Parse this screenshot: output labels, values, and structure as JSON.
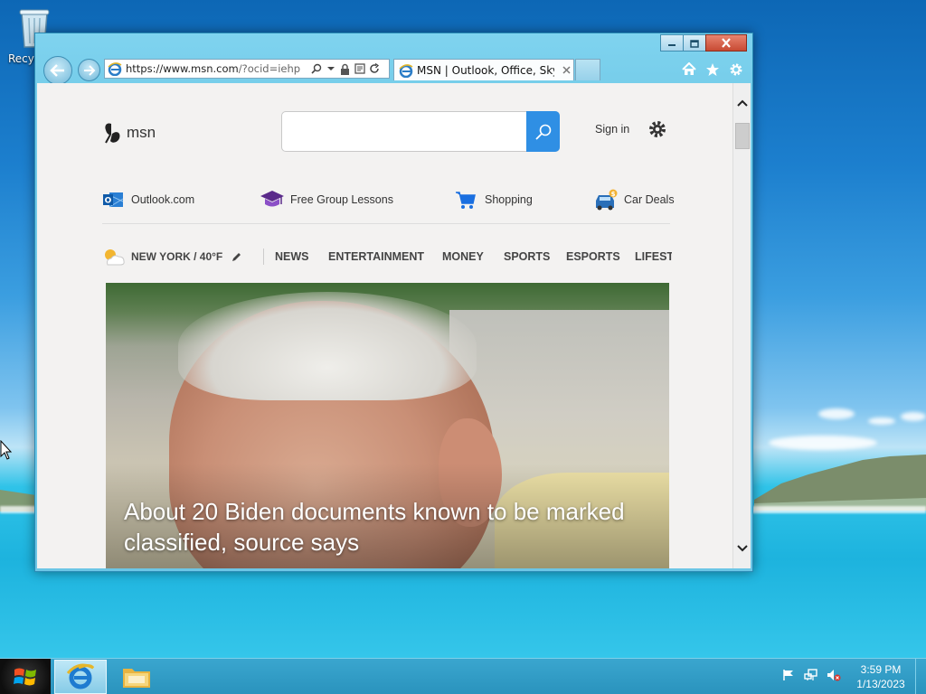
{
  "desktop": {
    "recycle_bin_label": "Recycle Bin"
  },
  "window": {
    "address": {
      "host": "https://www.msn.com",
      "path": "/?ocid=iehp"
    },
    "tab": {
      "title": "MSN | Outlook, Office, Skype, Bing, Breaking News, and Latest Videos"
    }
  },
  "msn": {
    "logo_text": "msn",
    "search_placeholder": "",
    "sign_in": "Sign in",
    "quick_links": [
      {
        "label": "Outlook.com",
        "icon": "outlook-icon"
      },
      {
        "label": "Free Group Lessons",
        "icon": "graduation-cap-icon"
      },
      {
        "label": "Shopping",
        "icon": "shopping-cart-icon"
      },
      {
        "label": "Car Deals",
        "icon": "car-icon"
      }
    ],
    "weather": {
      "text": "NEW YORK / 40°F",
      "icon": "partly-cloudy-icon"
    },
    "nav": [
      "NEWS",
      "ENTERTAINMENT",
      "MONEY",
      "SPORTS",
      "ESPORTS",
      "LIFESTYLE"
    ],
    "hero": {
      "headline": "About 20 Biden documents known to be marked classified, source says"
    }
  },
  "taskbar": {
    "time": "3:59 PM",
    "date": "1/13/2023"
  }
}
